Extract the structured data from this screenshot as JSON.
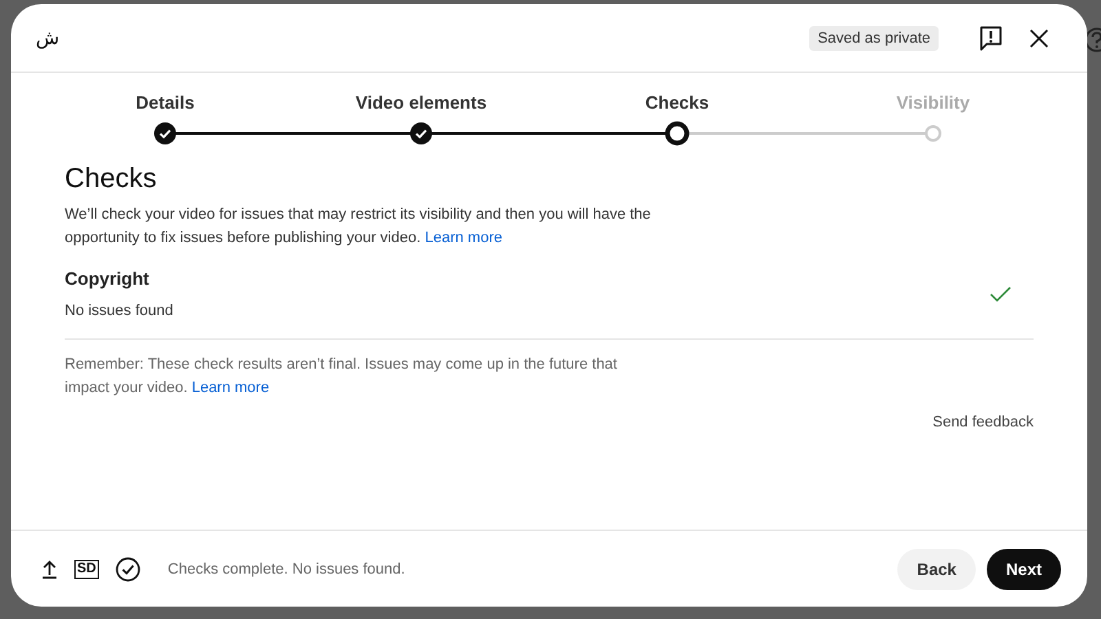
{
  "header": {
    "title": "ش",
    "badge": "Saved as private"
  },
  "steps": [
    {
      "label": "Details",
      "completed": true,
      "selected": false
    },
    {
      "label": "Video elements",
      "completed": true,
      "selected": false
    },
    {
      "label": "Checks",
      "completed": false,
      "selected": true
    },
    {
      "label": "Visibility",
      "completed": false,
      "selected": false
    }
  ],
  "checks": {
    "heading": "Checks",
    "intro": "We’ll check your video for issues that may restrict its visibility and then you will have the opportunity to fix issues before publishing your video.",
    "intro_link": "Learn more",
    "items": [
      {
        "title": "Copyright",
        "result": "No issues found",
        "passed": true
      }
    ],
    "remember": "Remember: These check results aren’t final. Issues may come up in the future that impact your video.",
    "remember_link": "Learn more",
    "feedback": "Send feedback"
  },
  "footer": {
    "quality": "SD",
    "status": "Checks complete. No issues found.",
    "buttons": [
      {
        "label": "Back",
        "primary": false
      },
      {
        "label": "Next",
        "primary": true
      }
    ]
  }
}
